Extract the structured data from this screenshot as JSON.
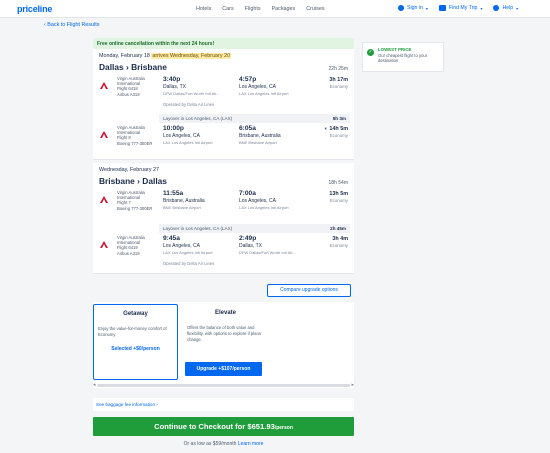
{
  "header": {
    "logo": "priceline",
    "nav": [
      "Hotels",
      "Cars",
      "Flights",
      "Packages",
      "Cruises"
    ],
    "sign_in": "Sign in",
    "find_my_trip": "Find My Trip",
    "help": "Help"
  },
  "back_link": "‹ Back to Flight Results",
  "cancel_banner": "Free online cancellation within the next 24 hours!",
  "outbound": {
    "date": "Monday, February 18",
    "arrives": "arrives Wednesday, February 20",
    "route": "Dallas › Brisbane",
    "duration": "22h 25m",
    "segments": [
      {
        "airline": [
          "Virgin Australia",
          "International",
          "Flight 6418",
          "Airbus A319"
        ],
        "dep_time": "3:40p",
        "dep_city": "Dallas, TX",
        "dep_airport": "DFW Dallas/Fort Worth Intl Air...",
        "arr_time": "4:57p",
        "arr_city": "Los Angeles, CA",
        "arr_airport": "LAX Los Angeles Intl Airport",
        "duration": "3h 17m",
        "cabin": "Economy",
        "operated": "Operated by Delta Air Lines"
      },
      {
        "airline": [
          "Virgin Australia",
          "International",
          "Flight 8",
          "Boeing 777-300ER"
        ],
        "dep_time": "10:00p",
        "dep_city": "Los Angeles, CA",
        "dep_airport": "LAX Los Angeles Intl Airport",
        "arr_time": "6:05a",
        "arr_city": "Brisbane, Australia",
        "arr_airport": "BNE Brisbane Airport",
        "duration": "14h 5m",
        "cabin": "Economy",
        "operated": ""
      }
    ],
    "layover_text": "Layover in Los Angeles, CA (LAX)",
    "layover_time": "5h 3m"
  },
  "inbound": {
    "date": "Wednesday, February 27",
    "route": "Brisbane › Dallas",
    "duration": "18h 54m",
    "segments": [
      {
        "airline": [
          "Virgin Australia",
          "International",
          "Flight 7",
          "Boeing 777-300ER"
        ],
        "dep_time": "11:55a",
        "dep_city": "Brisbane, Australia",
        "dep_airport": "BNE Brisbane Airport",
        "arr_time": "7:00a",
        "arr_city": "Los Angeles, CA",
        "arr_airport": "LAX Los Angeles Intl Airport",
        "duration": "13h 5m",
        "cabin": "Economy",
        "operated": ""
      },
      {
        "airline": [
          "Virgin Australia",
          "International",
          "Flight 6419",
          "Airbus A319"
        ],
        "dep_time": "9:45a",
        "dep_city": "Los Angeles, CA",
        "dep_airport": "LAX Los Angeles Intl Airport",
        "arr_time": "2:49p",
        "arr_city": "Dallas, TX",
        "arr_airport": "DFW Dallas/Fort Worth Intl Air...",
        "duration": "3h 4m",
        "cabin": "Economy",
        "operated": "Operated by Delta Air Lines"
      }
    ],
    "layover_text": "Layover in Los Angeles, CA (LAX)",
    "layover_time": "2h 45m"
  },
  "lowest_price": {
    "title": "LOWEST PRICE",
    "desc": "Our cheapest flight to your destination"
  },
  "compare_button": "Compare upgrade options",
  "getaway": {
    "name": "Getaway",
    "desc": "Enjoy the value-for-money comfort of Economy",
    "selected": "Selected +$0/person"
  },
  "elevate": {
    "name": "Elevate",
    "desc": "Offers the balance of both value and flexibility, with options to explore if plans change.",
    "button": "Upgrade +$107/person"
  },
  "baggage_link": "See baggage fee information  ›",
  "checkout": {
    "label": "Continue to Checkout for $651.93",
    "per": "/person"
  },
  "as_low": {
    "text": "Or as low as $59/month",
    "link": "Learn more"
  },
  "colors": {
    "brand": "#0068ef",
    "green": "#1f9d3a",
    "highlight": "#fde9a8"
  }
}
